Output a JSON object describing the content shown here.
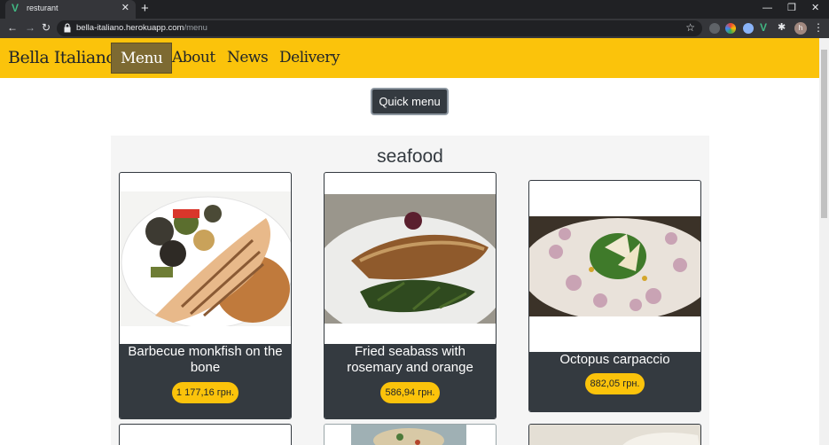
{
  "browser": {
    "tab_title": "resturant",
    "url_host": "bella-italiano.herokuapp.com",
    "url_path": "/menu",
    "avatar_letter": "h"
  },
  "navbar": {
    "brand": "Bella Italiano",
    "links": [
      "Menu",
      "About",
      "News",
      "Delivery"
    ],
    "active": "Menu"
  },
  "quick_menu_label": "Quick menu",
  "section": {
    "title": "seafood",
    "items": [
      {
        "name": "Barbecue monkfish on the bone",
        "price": "1 177,16 грн."
      },
      {
        "name": "Fried seabass with rosemary and orange",
        "price": "586,94 грн."
      },
      {
        "name": "Octopus carpaccio",
        "price": "882,05 грн."
      }
    ]
  },
  "colors": {
    "accent": "#fbc30b",
    "dark": "#343a40",
    "active_nav": "#7d6a32"
  }
}
